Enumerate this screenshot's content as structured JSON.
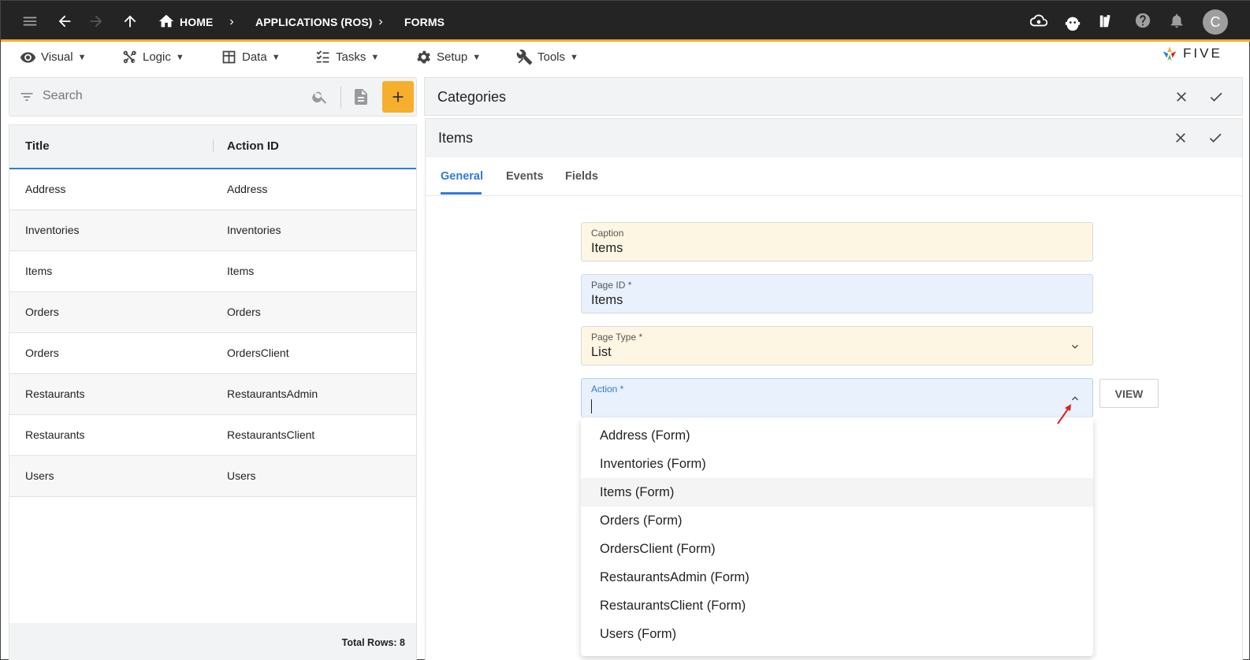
{
  "topbar": {
    "breadcrumbs": [
      "HOME",
      "APPLICATIONS (ROS)",
      "FORMS"
    ],
    "avatar_letter": "C"
  },
  "menu": {
    "items": [
      {
        "label": "Visual",
        "icon": "eye-icon"
      },
      {
        "label": "Logic",
        "icon": "logic-icon"
      },
      {
        "label": "Data",
        "icon": "table-icon"
      },
      {
        "label": "Tasks",
        "icon": "checklist-icon"
      },
      {
        "label": "Setup",
        "icon": "gear-icon"
      },
      {
        "label": "Tools",
        "icon": "tools-icon"
      }
    ],
    "caret": "▼"
  },
  "logo": {
    "text": "FIVE"
  },
  "search": {
    "placeholder": "Search"
  },
  "table": {
    "columns": [
      "Title",
      "Action ID"
    ],
    "rows": [
      [
        "Address",
        "Address"
      ],
      [
        "Inventories",
        "Inventories"
      ],
      [
        "Items",
        "Items"
      ],
      [
        "Orders",
        "Orders"
      ],
      [
        "Orders",
        "OrdersClient"
      ],
      [
        "Restaurants",
        "RestaurantsAdmin"
      ],
      [
        "Restaurants",
        "RestaurantsClient"
      ],
      [
        "Users",
        "Users"
      ]
    ],
    "total_rows": "Total Rows: 8"
  },
  "categories_panel": {
    "title": "Categories"
  },
  "items_panel": {
    "title": "Items",
    "tabs": [
      "General",
      "Events",
      "Fields"
    ],
    "active_tab": "General"
  },
  "form": {
    "caption": {
      "label": "Caption",
      "value": "Items"
    },
    "page_id": {
      "label": "Page ID *",
      "value": "Items"
    },
    "page_type": {
      "label": "Page Type *",
      "value": "List"
    },
    "action": {
      "label": "Action *",
      "value": ""
    },
    "view_button": "VIEW"
  },
  "dropdown": {
    "options": [
      "Address (Form)",
      "Inventories (Form)",
      "Items (Form)",
      "Orders (Form)",
      "OrdersClient (Form)",
      "RestaurantsAdmin (Form)",
      "RestaurantsClient (Form)",
      "Users (Form)"
    ],
    "highlighted": "Items (Form)"
  },
  "colors": {
    "topbar_bg": "#242424",
    "accent": "#f6ae2d",
    "link_blue": "#2f7bd8",
    "required_yellow": "#fdf6e3",
    "focus_blue": "#e8f1fc",
    "annotation_red": "#e02020"
  }
}
